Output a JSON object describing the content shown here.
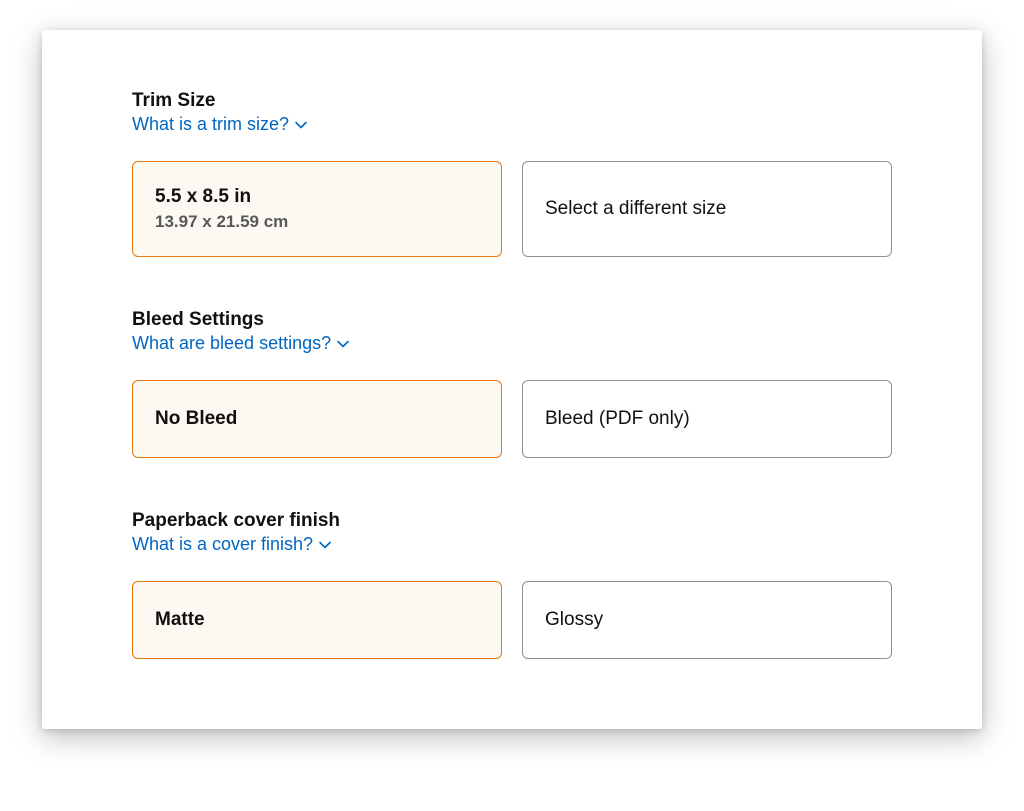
{
  "trimSize": {
    "title": "Trim Size",
    "helpLink": "What is a trim size?",
    "selected": {
      "primary": "5.5 x 8.5 in",
      "secondary": "13.97 x 21.59 cm"
    },
    "alternate": {
      "primary": "Select a different size"
    }
  },
  "bleed": {
    "title": "Bleed Settings",
    "helpLink": "What are bleed settings?",
    "selected": {
      "primary": "No Bleed"
    },
    "alternate": {
      "primary": "Bleed (PDF only)"
    }
  },
  "coverFinish": {
    "title": "Paperback cover finish",
    "helpLink": "What is a cover finish?",
    "selected": {
      "primary": "Matte"
    },
    "alternate": {
      "primary": "Glossy"
    }
  }
}
